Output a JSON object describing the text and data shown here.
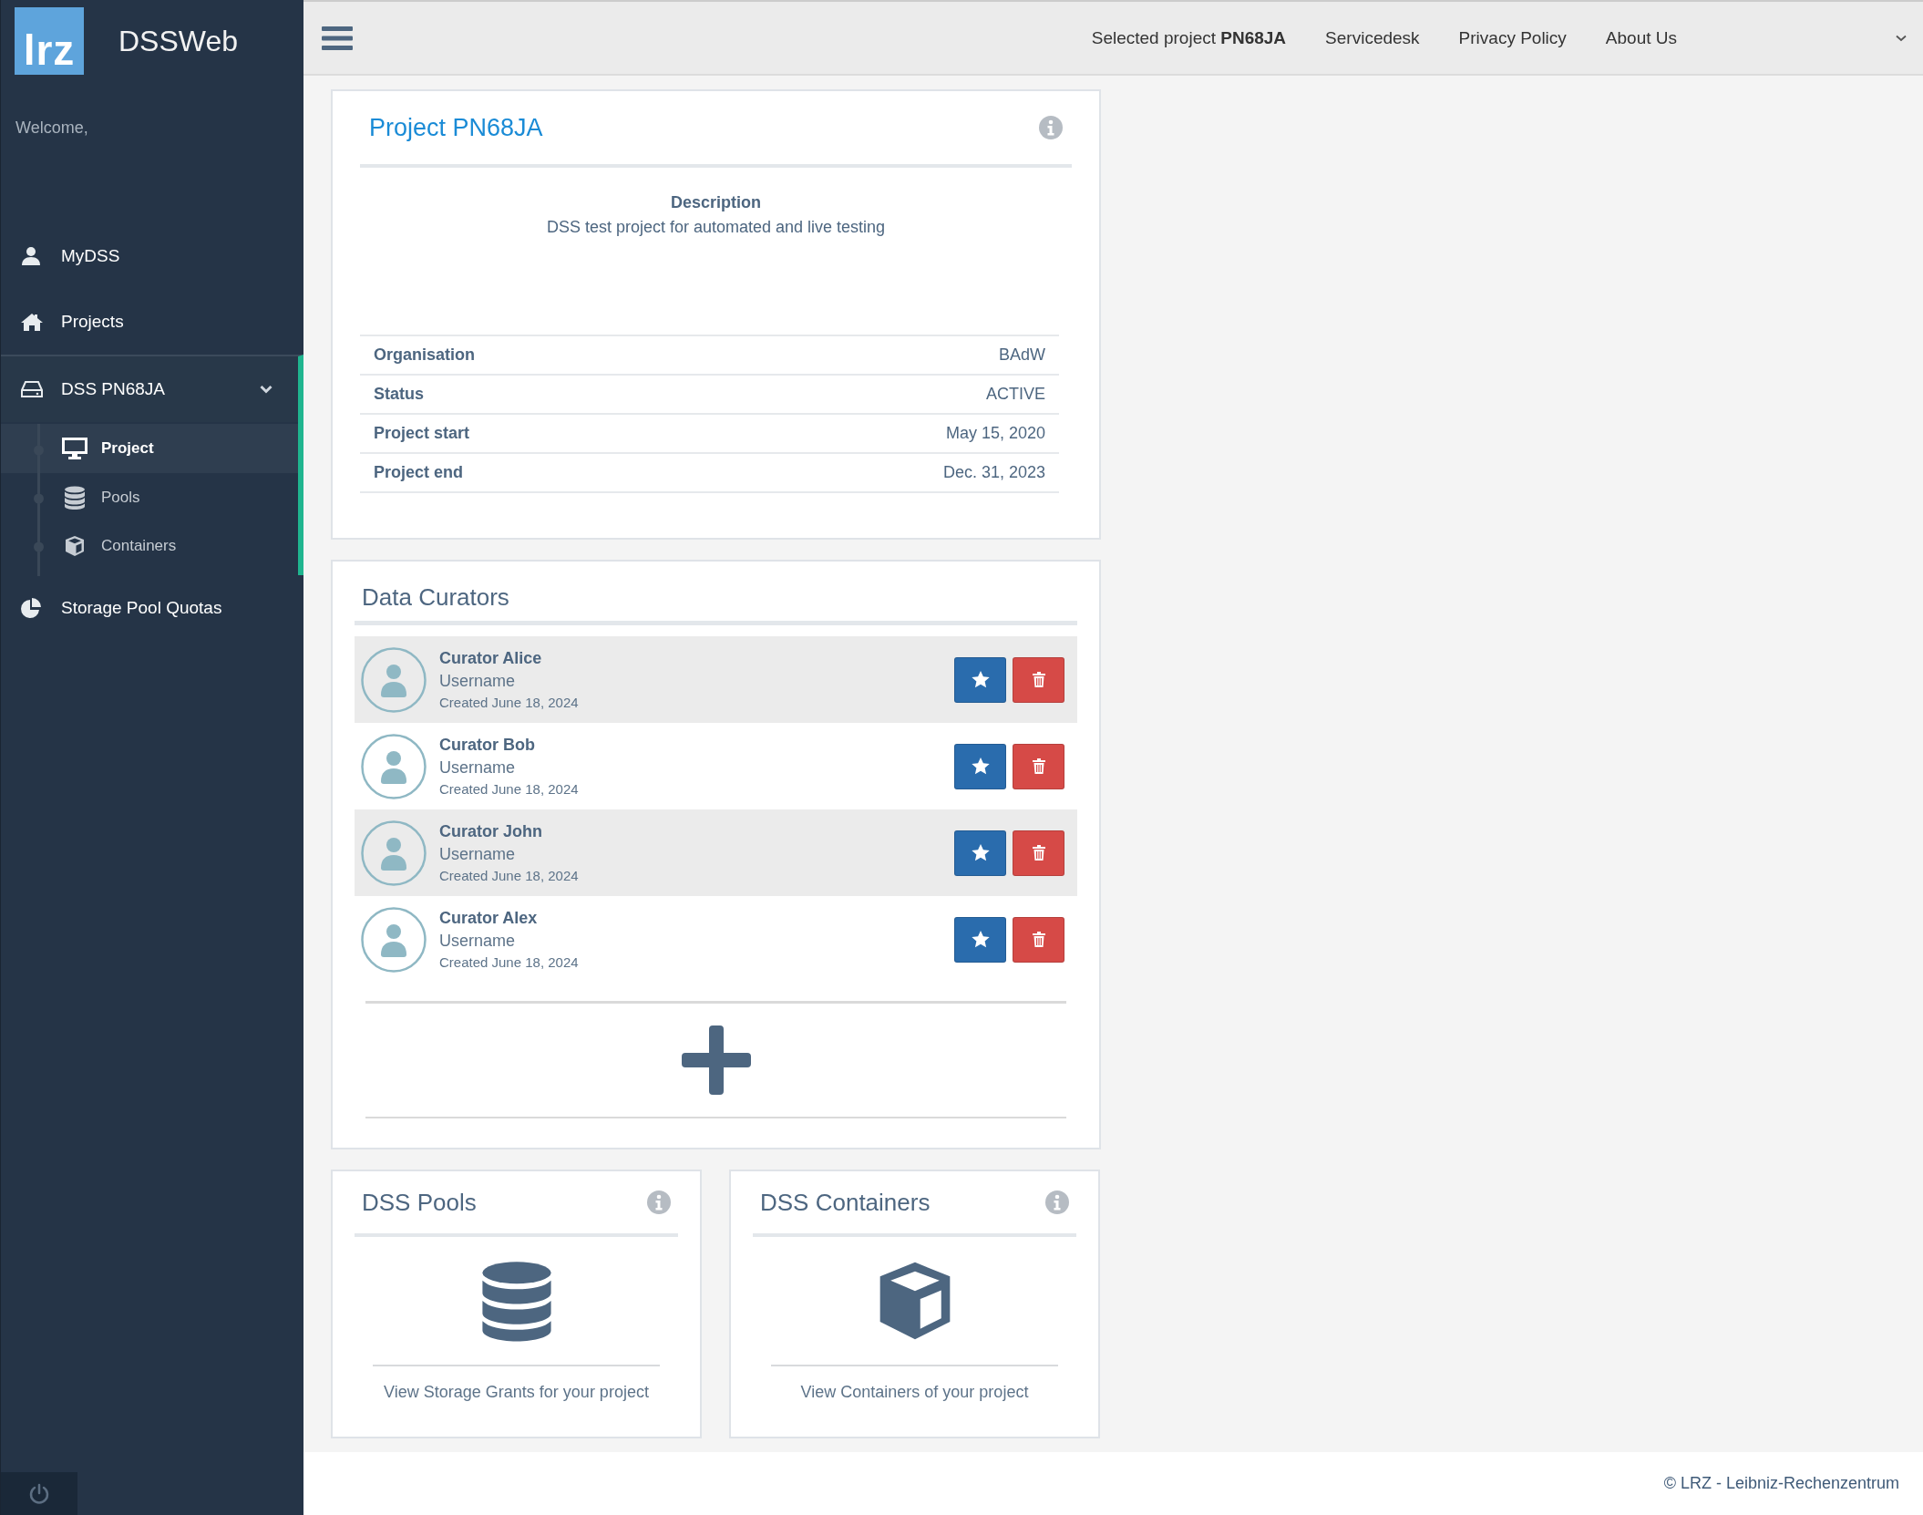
{
  "sidebar": {
    "logo": "lrz",
    "app_title": "DSSWeb",
    "welcome": "Welcome,",
    "items": [
      {
        "label": "MyDSS",
        "selected": false
      },
      {
        "label": "Projects",
        "selected": false
      },
      {
        "label": "DSS PN68JA",
        "selected": true,
        "expanded": true,
        "children": [
          {
            "label": "Project",
            "selected": true
          },
          {
            "label": "Pools",
            "selected": false
          },
          {
            "label": "Containers",
            "selected": false
          }
        ]
      },
      {
        "label": "Storage Pool Quotas",
        "selected": false
      }
    ]
  },
  "topbar": {
    "links": [
      "Selected project **PN68JA**",
      "Servicedesk",
      "Privacy Policy",
      "About Us"
    ]
  },
  "project_card": {
    "title": "Project PN68JA",
    "description_heading": "Description",
    "description": "DSS test project for automated and live testing",
    "details": [
      {
        "label": "Organisation",
        "value": "BAdW"
      },
      {
        "label": "Status",
        "value": "ACTIVE"
      },
      {
        "label": "Project start",
        "value": "May 15, 2020"
      },
      {
        "label": "Project end",
        "value": "Dec. 31, 2023"
      }
    ]
  },
  "curators": {
    "title": "Data Curators",
    "items": [
      {
        "name": "Curator Alice",
        "username": "Username",
        "created": "Created June 18, 2024"
      },
      {
        "name": "Curator Bob",
        "username": "Username",
        "created": "Created June 18, 2024"
      },
      {
        "name": "Curator John",
        "username": "Username",
        "created": "Created June 18, 2024"
      },
      {
        "name": "Curator Alex",
        "username": "Username",
        "created": "Created June 18, 2024"
      }
    ]
  },
  "tiles": [
    {
      "title": "DSS Pools",
      "link": "View Storage Grants for your project"
    },
    {
      "title": "DSS Containers",
      "link": "View Containers of your project"
    }
  ],
  "footer": "© LRZ - Leibniz-Rechenzentrum"
}
